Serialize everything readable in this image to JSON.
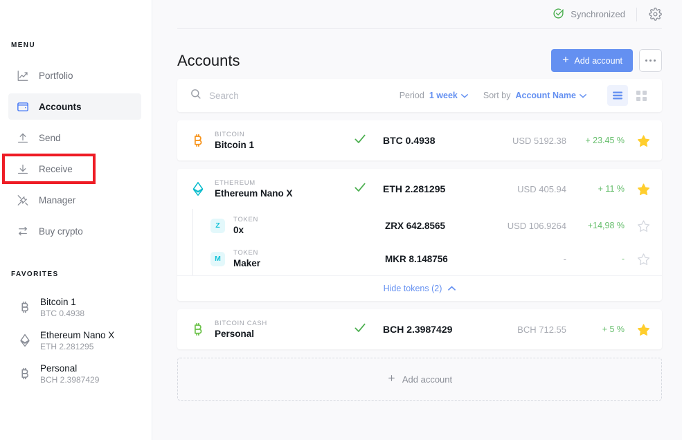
{
  "sidebar": {
    "menu_heading": "MENU",
    "favorites_heading": "FAVORITES",
    "menu_items": [
      {
        "label": "Portfolio",
        "icon": "chart-line-icon",
        "active": false
      },
      {
        "label": "Accounts",
        "icon": "wallet-icon",
        "active": true
      },
      {
        "label": "Send",
        "icon": "arrow-up-icon",
        "active": false
      },
      {
        "label": "Receive",
        "icon": "arrow-down-icon",
        "active": false
      },
      {
        "label": "Manager",
        "icon": "tools-icon",
        "active": false
      },
      {
        "label": "Buy crypto",
        "icon": "exchange-icon",
        "active": false
      }
    ],
    "favorites": [
      {
        "name": "Bitcoin 1",
        "amount": "BTC 0.4938",
        "icon": "bitcoin-icon"
      },
      {
        "name": "Ethereum Nano X",
        "amount": "ETH 2.281295",
        "icon": "ethereum-icon"
      },
      {
        "name": "Personal",
        "amount": "BCH 2.3987429",
        "icon": "bitcoin-cash-icon"
      }
    ]
  },
  "topbar": {
    "sync_status": "Synchronized",
    "sync_icon": "check-circle-icon",
    "settings_icon": "gear-icon"
  },
  "header": {
    "title": "Accounts",
    "add_account_label": "Add account",
    "more_icon": "ellipsis-icon"
  },
  "toolbar": {
    "search_placeholder": "Search",
    "search_value": "",
    "search_icon": "search-icon",
    "period_label": "Period",
    "period_value": "1 week",
    "sort_label": "Sort by",
    "sort_value": "Account Name",
    "list_view_icon": "list-view-icon",
    "grid_view_icon": "grid-view-icon",
    "active_view": "list"
  },
  "accounts": [
    {
      "type": "BITCOIN",
      "name": "Bitcoin 1",
      "icon": "bitcoin-icon",
      "icon_color": "#f7931a",
      "status_icon": "check-icon",
      "amount": "BTC 0.4938",
      "countervalue": "USD 5192.38",
      "change": "+ 23.45 %",
      "starred": true,
      "tokens": []
    },
    {
      "type": "ETHEREUM",
      "name": "Ethereum Nano X",
      "icon": "ethereum-icon",
      "icon_color": "#0ebdcd",
      "status_icon": "check-icon",
      "amount": "ETH 2.281295",
      "countervalue": "USD 405.94",
      "change": "+ 11 %",
      "starred": true,
      "hide_tokens_label": "Hide tokens (2)",
      "tokens": [
        {
          "type": "TOKEN",
          "name": "0x",
          "badge": "Z",
          "amount": "ZRX 642.8565",
          "countervalue": "USD 106.9264",
          "change": "+14,98 %",
          "starred": false
        },
        {
          "type": "TOKEN",
          "name": "Maker",
          "badge": "M",
          "amount": "MKR 8.148756",
          "countervalue": "-",
          "change": "-",
          "starred": false
        }
      ]
    },
    {
      "type": "BITCOIN CASH",
      "name": "Personal",
      "icon": "bitcoin-cash-icon",
      "icon_color": "#6cc24a",
      "status_icon": "check-icon",
      "amount": "BCH 2.3987429",
      "countervalue": "BCH 712.55",
      "change": "+ 5 %",
      "starred": true,
      "tokens": []
    }
  ],
  "footer": {
    "add_account_label": "Add account"
  },
  "colors": {
    "accent": "#6490f1",
    "positive": "#66be6c",
    "star": "#ffce2e",
    "annotation": "#ee1c25"
  }
}
